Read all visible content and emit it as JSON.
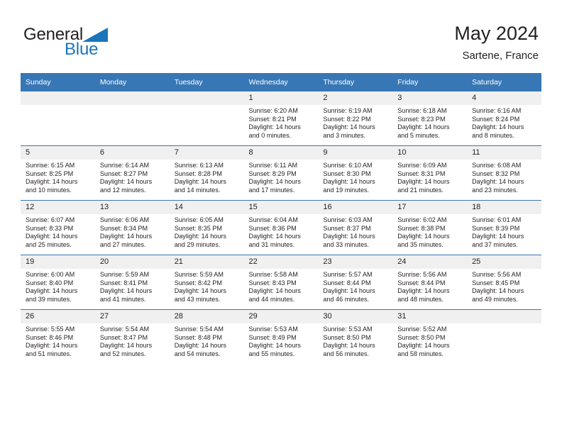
{
  "brand": {
    "name_part1": "General",
    "name_part2": "Blue",
    "triangle_color": "#1b75bb"
  },
  "header": {
    "title": "May 2024",
    "subtitle": "Sartene, France"
  },
  "theme": {
    "header_blue": "#3877b5",
    "daynum_band": "#f0f0f0",
    "text": "#231f20",
    "brand_blue": "#1b75bb"
  },
  "weekday_headers": [
    "Sunday",
    "Monday",
    "Tuesday",
    "Wednesday",
    "Thursday",
    "Friday",
    "Saturday"
  ],
  "weeks": [
    [
      {
        "day": "",
        "empty": true
      },
      {
        "day": "",
        "empty": true
      },
      {
        "day": "",
        "empty": true
      },
      {
        "day": "1",
        "sunrise": "Sunrise: 6:20 AM",
        "sunset": "Sunset: 8:21 PM",
        "daylight1": "Daylight: 14 hours",
        "daylight2": "and 0 minutes."
      },
      {
        "day": "2",
        "sunrise": "Sunrise: 6:19 AM",
        "sunset": "Sunset: 8:22 PM",
        "daylight1": "Daylight: 14 hours",
        "daylight2": "and 3 minutes."
      },
      {
        "day": "3",
        "sunrise": "Sunrise: 6:18 AM",
        "sunset": "Sunset: 8:23 PM",
        "daylight1": "Daylight: 14 hours",
        "daylight2": "and 5 minutes."
      },
      {
        "day": "4",
        "sunrise": "Sunrise: 6:16 AM",
        "sunset": "Sunset: 8:24 PM",
        "daylight1": "Daylight: 14 hours",
        "daylight2": "and 8 minutes."
      }
    ],
    [
      {
        "day": "5",
        "sunrise": "Sunrise: 6:15 AM",
        "sunset": "Sunset: 8:25 PM",
        "daylight1": "Daylight: 14 hours",
        "daylight2": "and 10 minutes."
      },
      {
        "day": "6",
        "sunrise": "Sunrise: 6:14 AM",
        "sunset": "Sunset: 8:27 PM",
        "daylight1": "Daylight: 14 hours",
        "daylight2": "and 12 minutes."
      },
      {
        "day": "7",
        "sunrise": "Sunrise: 6:13 AM",
        "sunset": "Sunset: 8:28 PM",
        "daylight1": "Daylight: 14 hours",
        "daylight2": "and 14 minutes."
      },
      {
        "day": "8",
        "sunrise": "Sunrise: 6:11 AM",
        "sunset": "Sunset: 8:29 PM",
        "daylight1": "Daylight: 14 hours",
        "daylight2": "and 17 minutes."
      },
      {
        "day": "9",
        "sunrise": "Sunrise: 6:10 AM",
        "sunset": "Sunset: 8:30 PM",
        "daylight1": "Daylight: 14 hours",
        "daylight2": "and 19 minutes."
      },
      {
        "day": "10",
        "sunrise": "Sunrise: 6:09 AM",
        "sunset": "Sunset: 8:31 PM",
        "daylight1": "Daylight: 14 hours",
        "daylight2": "and 21 minutes."
      },
      {
        "day": "11",
        "sunrise": "Sunrise: 6:08 AM",
        "sunset": "Sunset: 8:32 PM",
        "daylight1": "Daylight: 14 hours",
        "daylight2": "and 23 minutes."
      }
    ],
    [
      {
        "day": "12",
        "sunrise": "Sunrise: 6:07 AM",
        "sunset": "Sunset: 8:33 PM",
        "daylight1": "Daylight: 14 hours",
        "daylight2": "and 25 minutes."
      },
      {
        "day": "13",
        "sunrise": "Sunrise: 6:06 AM",
        "sunset": "Sunset: 8:34 PM",
        "daylight1": "Daylight: 14 hours",
        "daylight2": "and 27 minutes."
      },
      {
        "day": "14",
        "sunrise": "Sunrise: 6:05 AM",
        "sunset": "Sunset: 8:35 PM",
        "daylight1": "Daylight: 14 hours",
        "daylight2": "and 29 minutes."
      },
      {
        "day": "15",
        "sunrise": "Sunrise: 6:04 AM",
        "sunset": "Sunset: 8:36 PM",
        "daylight1": "Daylight: 14 hours",
        "daylight2": "and 31 minutes."
      },
      {
        "day": "16",
        "sunrise": "Sunrise: 6:03 AM",
        "sunset": "Sunset: 8:37 PM",
        "daylight1": "Daylight: 14 hours",
        "daylight2": "and 33 minutes."
      },
      {
        "day": "17",
        "sunrise": "Sunrise: 6:02 AM",
        "sunset": "Sunset: 8:38 PM",
        "daylight1": "Daylight: 14 hours",
        "daylight2": "and 35 minutes."
      },
      {
        "day": "18",
        "sunrise": "Sunrise: 6:01 AM",
        "sunset": "Sunset: 8:39 PM",
        "daylight1": "Daylight: 14 hours",
        "daylight2": "and 37 minutes."
      }
    ],
    [
      {
        "day": "19",
        "sunrise": "Sunrise: 6:00 AM",
        "sunset": "Sunset: 8:40 PM",
        "daylight1": "Daylight: 14 hours",
        "daylight2": "and 39 minutes."
      },
      {
        "day": "20",
        "sunrise": "Sunrise: 5:59 AM",
        "sunset": "Sunset: 8:41 PM",
        "daylight1": "Daylight: 14 hours",
        "daylight2": "and 41 minutes."
      },
      {
        "day": "21",
        "sunrise": "Sunrise: 5:59 AM",
        "sunset": "Sunset: 8:42 PM",
        "daylight1": "Daylight: 14 hours",
        "daylight2": "and 43 minutes."
      },
      {
        "day": "22",
        "sunrise": "Sunrise: 5:58 AM",
        "sunset": "Sunset: 8:43 PM",
        "daylight1": "Daylight: 14 hours",
        "daylight2": "and 44 minutes."
      },
      {
        "day": "23",
        "sunrise": "Sunrise: 5:57 AM",
        "sunset": "Sunset: 8:44 PM",
        "daylight1": "Daylight: 14 hours",
        "daylight2": "and 46 minutes."
      },
      {
        "day": "24",
        "sunrise": "Sunrise: 5:56 AM",
        "sunset": "Sunset: 8:44 PM",
        "daylight1": "Daylight: 14 hours",
        "daylight2": "and 48 minutes."
      },
      {
        "day": "25",
        "sunrise": "Sunrise: 5:56 AM",
        "sunset": "Sunset: 8:45 PM",
        "daylight1": "Daylight: 14 hours",
        "daylight2": "and 49 minutes."
      }
    ],
    [
      {
        "day": "26",
        "sunrise": "Sunrise: 5:55 AM",
        "sunset": "Sunset: 8:46 PM",
        "daylight1": "Daylight: 14 hours",
        "daylight2": "and 51 minutes."
      },
      {
        "day": "27",
        "sunrise": "Sunrise: 5:54 AM",
        "sunset": "Sunset: 8:47 PM",
        "daylight1": "Daylight: 14 hours",
        "daylight2": "and 52 minutes."
      },
      {
        "day": "28",
        "sunrise": "Sunrise: 5:54 AM",
        "sunset": "Sunset: 8:48 PM",
        "daylight1": "Daylight: 14 hours",
        "daylight2": "and 54 minutes."
      },
      {
        "day": "29",
        "sunrise": "Sunrise: 5:53 AM",
        "sunset": "Sunset: 8:49 PM",
        "daylight1": "Daylight: 14 hours",
        "daylight2": "and 55 minutes."
      },
      {
        "day": "30",
        "sunrise": "Sunrise: 5:53 AM",
        "sunset": "Sunset: 8:50 PM",
        "daylight1": "Daylight: 14 hours",
        "daylight2": "and 56 minutes."
      },
      {
        "day": "31",
        "sunrise": "Sunrise: 5:52 AM",
        "sunset": "Sunset: 8:50 PM",
        "daylight1": "Daylight: 14 hours",
        "daylight2": "and 58 minutes."
      },
      {
        "day": "",
        "empty": true
      }
    ]
  ]
}
